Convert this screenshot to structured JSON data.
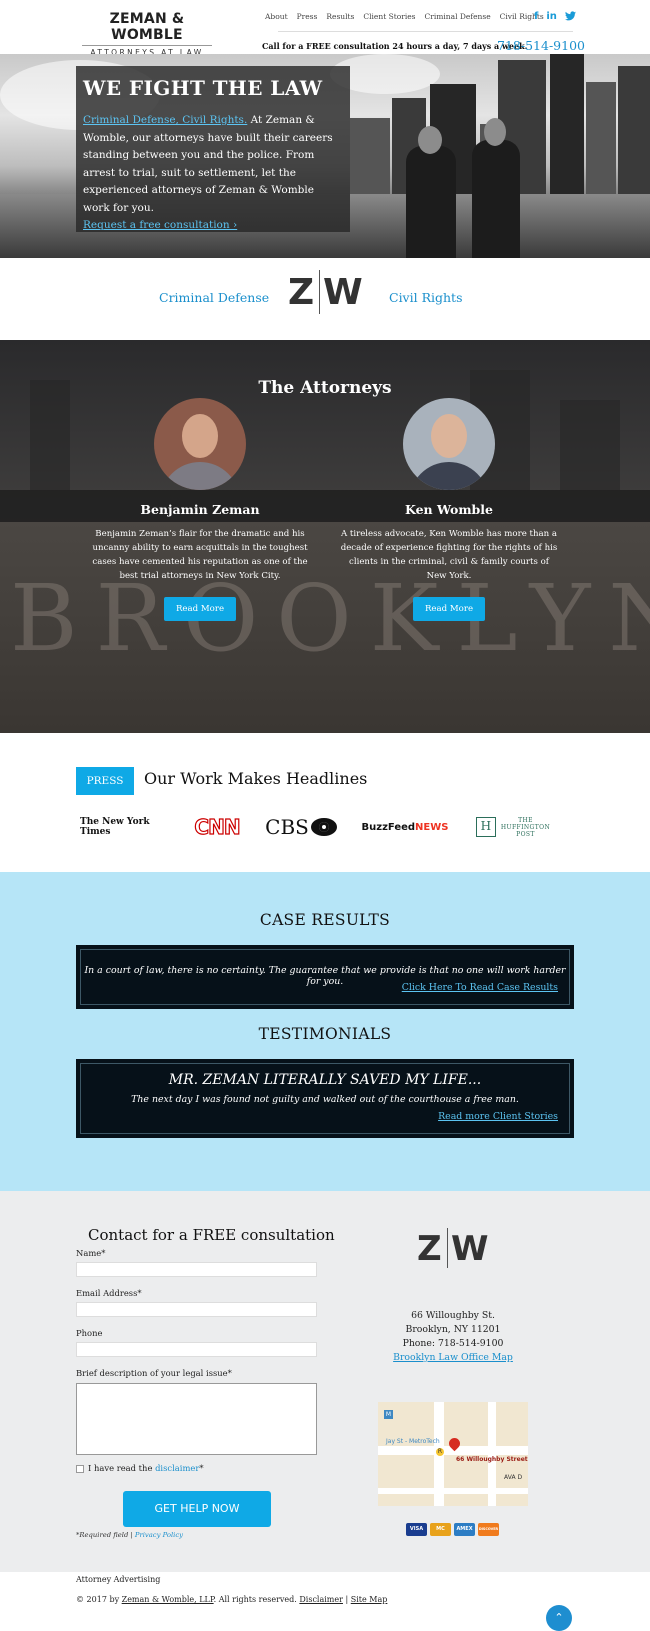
{
  "header": {
    "logo_name": "ZEMAN & WOMBLE",
    "logo_sub": "ATTORNEYS AT LAW",
    "nav": [
      "About",
      "Press",
      "Results",
      "Client Stories",
      "Criminal Defense",
      "Civil Rights"
    ],
    "social": [
      "facebook-icon",
      "linkedin-icon",
      "twitter-icon"
    ],
    "call_text": "Call for a FREE consultation 24 hours a day, 7 days a week.",
    "phone": "718-514-9100"
  },
  "hero": {
    "title": "WE FIGHT THE LAW",
    "lead_link": "Criminal Defense, Civil Rights.",
    "body": " At Zeman & Womble, our attorneys have built their careers standing between you and the police. From arrest to trial, suit to settlement, let the experienced attorneys of Zeman & Womble work for you.",
    "cta": "Request a free consultation ›"
  },
  "practice": {
    "left": "Criminal Defense",
    "right": "Civil Rights",
    "mark_left": "Z",
    "mark_right": "W"
  },
  "attorneys": {
    "title": "The Attorneys",
    "backdrop_text": "BROOKLYN",
    "people": [
      {
        "name": "Benjamin Zeman",
        "bio": "Benjamin Zeman’s flair for the dramatic and his uncanny ability to earn acquittals in the toughest cases have cemented his reputation as one of the best trial attorneys in New York City.",
        "button": "Read More"
      },
      {
        "name": "Ken Womble",
        "bio": "A tireless advocate, Ken Womble has more than a decade of experience fighting for the rights of his clients in the criminal, civil & family courts of New York.",
        "button": "Read More"
      }
    ]
  },
  "press": {
    "tag": "PRESS",
    "title": "Our Work Makes Headlines",
    "outlets": {
      "nyt": "The New York Times",
      "cnn": "CNN",
      "cbs": "CBS",
      "buzzfeed_a": "BuzzFeed",
      "buzzfeed_b": "NEWS",
      "huff_mark": "H",
      "huff_line1": "THE",
      "huff_line2": "HUFFINGTON",
      "huff_line3": "POST"
    }
  },
  "results": {
    "title": "CASE RESULTS",
    "quote": "In a court of law, there is no certainty. The guarantee that we provide is that no one will work harder for you.",
    "link": "Click Here To Read Case Results"
  },
  "testimonials": {
    "title": "TESTIMONIALS",
    "headline": "MR. ZEMAN LITERALLY SAVED MY LIFE...",
    "quote": "The next day I was found not guilty and walked out of the courthouse a free man.",
    "link": "Read more Client Stories"
  },
  "contact": {
    "title": "Contact for a FREE consultation",
    "name_label": "Name*",
    "email_label": "Email Address*",
    "phone_label": "Phone",
    "issue_label": "Brief description of your legal issue*",
    "checkbox_label": "I have read the ",
    "checkbox_link": "disclaimer",
    "checkbox_suffix": "*",
    "button": "GET HELP NOW",
    "required_note": "*Required field | ",
    "privacy": "Privacy Policy",
    "address_line1": "66 Willoughby St.",
    "address_line2": "Brooklyn, NY 11201",
    "address_phone": "Phone: 718-514-9100",
    "map_link": "Brooklyn Law Office Map",
    "map_labels": {
      "station": "Jay St - MetroTech",
      "pin": "66 Willoughby Street",
      "avenue": "AVA D",
      "m1": "M",
      "r": "R"
    },
    "cards": [
      "VISA",
      "MC",
      "AMEX",
      "DISCOVER"
    ]
  },
  "footer": {
    "advertising": "Attorney Advertising",
    "copyright": "© 2017 by ",
    "firm_link": "Zeman & Womble, LLP",
    "rights": ". All rights reserved. ",
    "disclaimer": "Disclaimer",
    "sep": " | ",
    "sitemap": "Site Map",
    "top": "⌃"
  },
  "colors": {
    "accent": "#0fa9e6",
    "link": "#1a8fcc",
    "results_bg": "#b6e5f7",
    "dark_box": "#061119"
  }
}
